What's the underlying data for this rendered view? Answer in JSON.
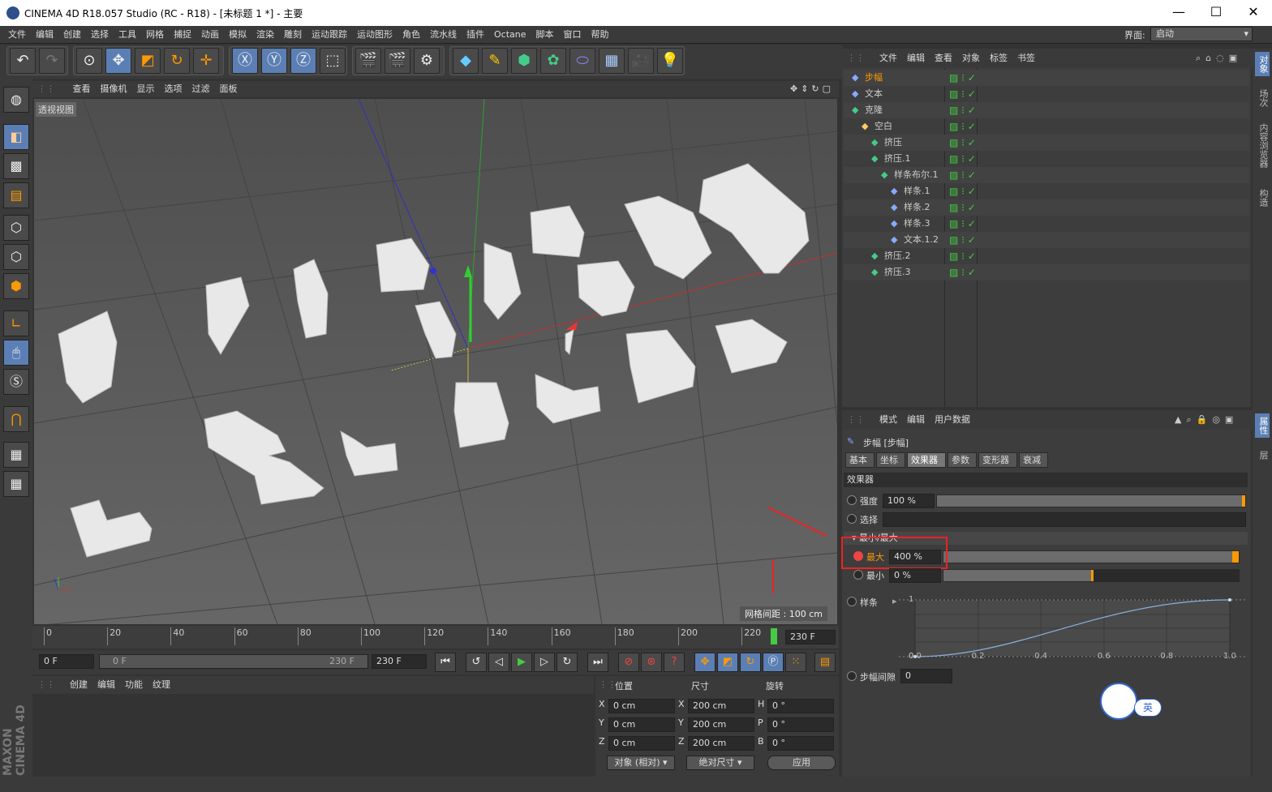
{
  "window": {
    "title": "CINEMA 4D R18.057 Studio (RC - R18) - [未标题 1 *] - 主要",
    "min": "—",
    "max": "☐",
    "close": "✕"
  },
  "menubar": {
    "items": [
      "文件",
      "编辑",
      "创建",
      "选择",
      "工具",
      "网格",
      "捕捉",
      "动画",
      "模拟",
      "渲染",
      "雕刻",
      "运动跟踪",
      "运动图形",
      "角色",
      "流水线",
      "插件",
      "Octane",
      "脚本",
      "窗口",
      "帮助"
    ],
    "layout_label": "界面:",
    "layout_value": "启动"
  },
  "viewport": {
    "menu": [
      "查看",
      "摄像机",
      "显示",
      "选项",
      "过滤",
      "面板"
    ],
    "label": "透视视图",
    "grid_spacing": "网格间距 : 100 cm"
  },
  "timeline": {
    "ticks": [
      "0",
      "20",
      "40",
      "60",
      "80",
      "100",
      "120",
      "140",
      "160",
      "180",
      "200",
      "220"
    ],
    "current": "230 F"
  },
  "playback": {
    "start": "0 F",
    "slider_start": "0 F",
    "slider_end": "230 F",
    "end": "230 F"
  },
  "material": {
    "menu": [
      "创建",
      "编辑",
      "功能",
      "纹理"
    ]
  },
  "coords": {
    "headers": [
      "位置",
      "尺寸",
      "旋转"
    ],
    "rows": [
      {
        "axis": "X",
        "pos": "0 cm",
        "size_axis": "X",
        "size": "200 cm",
        "rot_axis": "H",
        "rot": "0 °"
      },
      {
        "axis": "Y",
        "pos": "0 cm",
        "size_axis": "Y",
        "size": "200 cm",
        "rot_axis": "P",
        "rot": "0 °"
      },
      {
        "axis": "Z",
        "pos": "0 cm",
        "size_axis": "Z",
        "size": "200 cm",
        "rot_axis": "B",
        "rot": "0 °"
      }
    ],
    "mode": "对象 (相对)",
    "size_mode": "绝对尺寸",
    "apply": "应用"
  },
  "objects": {
    "menu": [
      "文件",
      "编辑",
      "查看",
      "对象",
      "标签",
      "书签"
    ],
    "tree": [
      {
        "name": "步幅",
        "indent": 0,
        "selected": true
      },
      {
        "name": "文本",
        "indent": 0
      },
      {
        "name": "克隆",
        "indent": 0
      },
      {
        "name": "空白",
        "indent": 1
      },
      {
        "name": "挤压",
        "indent": 2
      },
      {
        "name": "挤压.1",
        "indent": 2
      },
      {
        "name": "样条布尔.1",
        "indent": 3
      },
      {
        "name": "样条.1",
        "indent": 4
      },
      {
        "name": "样条.2",
        "indent": 4
      },
      {
        "name": "样条.3",
        "indent": 4
      },
      {
        "name": "文本.1.2",
        "indent": 4
      },
      {
        "name": "挤压.2",
        "indent": 2
      },
      {
        "name": "挤压.3",
        "indent": 2
      }
    ]
  },
  "attributes": {
    "menu": [
      "模式",
      "编辑",
      "用户数据"
    ],
    "object_title": "步幅 [步幅]",
    "tabs": [
      "基本",
      "坐标",
      "效果器",
      "参数",
      "变形器",
      "衰减"
    ],
    "active_tab": "效果器",
    "section": "效果器",
    "strength_label": "强度",
    "strength_value": "100 %",
    "selection_label": "选择",
    "minmax_label": "▾ 最小/最大",
    "max_label": "最大",
    "max_value": "400 %",
    "min_label": "最小",
    "min_value": "0 %",
    "spline_label": "样条",
    "spline_y_top": "1",
    "spline_x_ticks": [
      "0.0",
      "0.2",
      "0.4",
      "0.6",
      "0.8",
      "1.0"
    ],
    "spline_y_bottom": "0",
    "step_gap_label": "步幅间隙",
    "step_gap_value": "0",
    "ime_label": "英"
  },
  "sidebar": {
    "top_tabs": [
      "对象",
      "场次",
      "内容浏览器",
      "构造"
    ],
    "bottom_tabs": [
      "属性",
      "层"
    ]
  },
  "brand": "MAXON CINEMA 4D"
}
